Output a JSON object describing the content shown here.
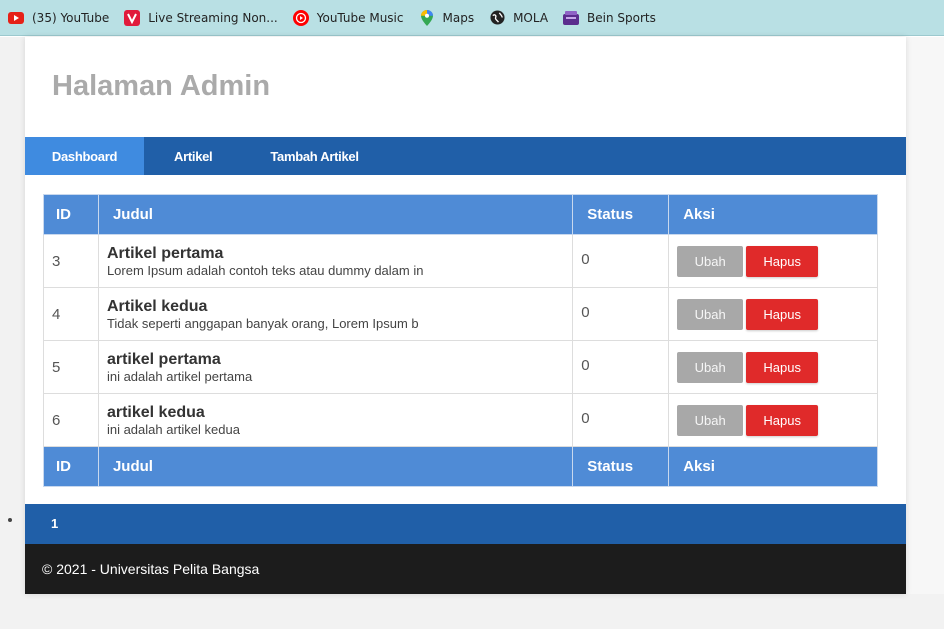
{
  "bookmarks": [
    {
      "label": "(35) YouTube",
      "icon": "youtube-icon"
    },
    {
      "label": "Live Streaming Non...",
      "icon": "vidio-icon"
    },
    {
      "label": "YouTube Music",
      "icon": "youtube-music-icon"
    },
    {
      "label": "Maps",
      "icon": "maps-pin-icon"
    },
    {
      "label": "MOLA",
      "icon": "mola-globe-icon"
    },
    {
      "label": "Bein Sports",
      "icon": "bein-sports-icon"
    }
  ],
  "header": {
    "title": "Halaman Admin"
  },
  "nav": {
    "items": [
      {
        "label": "Dashboard",
        "active": true
      },
      {
        "label": "Artikel",
        "active": false
      },
      {
        "label": "Tambah Artikel",
        "active": false
      }
    ]
  },
  "table": {
    "headers": {
      "id": "ID",
      "judul": "Judul",
      "status": "Status",
      "aksi": "Aksi"
    },
    "rows": [
      {
        "id": "3",
        "title": "Artikel pertama",
        "summary": "Lorem Ipsum adalah contoh teks atau dummy dalam in",
        "status": "0",
        "edit": "Ubah",
        "delete": "Hapus"
      },
      {
        "id": "4",
        "title": "Artikel kedua",
        "summary": "Tidak seperti anggapan banyak orang, Lorem Ipsum b",
        "status": "0",
        "edit": "Ubah",
        "delete": "Hapus"
      },
      {
        "id": "5",
        "title": "artikel pertama",
        "summary": "ini adalah artikel pertama",
        "status": "0",
        "edit": "Ubah",
        "delete": "Hapus"
      },
      {
        "id": "6",
        "title": "artikel kedua",
        "summary": "ini adalah artikel kedua",
        "status": "0",
        "edit": "Ubah",
        "delete": "Hapus"
      }
    ]
  },
  "pagination": {
    "current": "1"
  },
  "footer": {
    "text": "© 2021 - Universitas Pelita Bangsa"
  },
  "colors": {
    "nav": "#205fa8",
    "nav_active": "#3f8be0",
    "table_header": "#4f8bd6",
    "delete": "#e02a2a",
    "edit": "#a8a8a8",
    "footer": "#1c1c1c"
  }
}
